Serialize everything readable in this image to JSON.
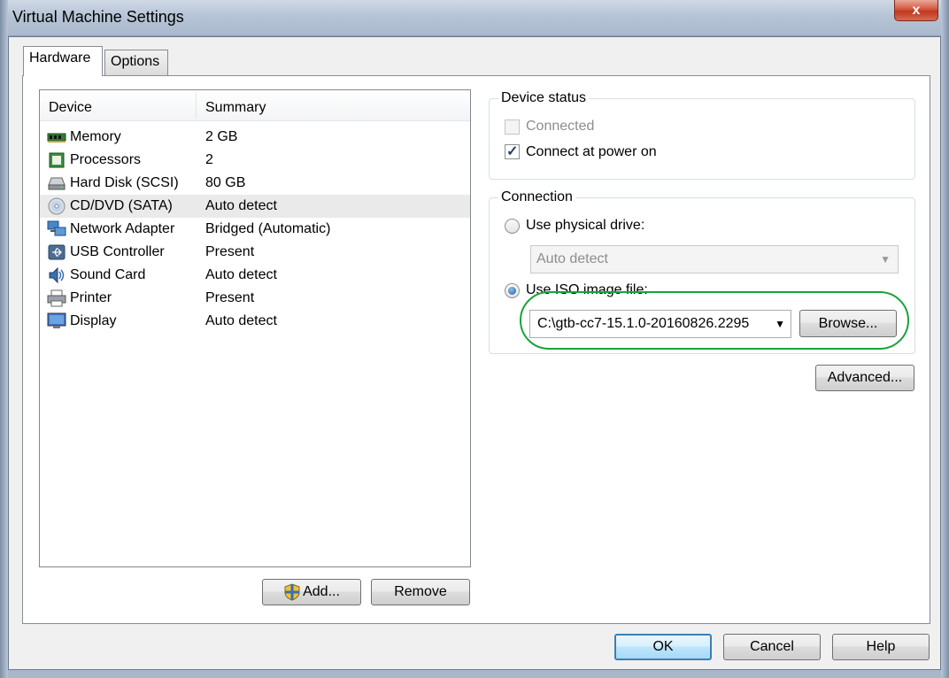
{
  "window": {
    "title": "Virtual Machine Settings",
    "close_glyph": "x"
  },
  "tabs": [
    {
      "label": "Hardware",
      "active": true
    },
    {
      "label": "Options",
      "active": false
    }
  ],
  "device_list": {
    "columns": {
      "device": "Device",
      "summary": "Summary"
    },
    "rows": [
      {
        "device": "Memory",
        "summary": "2 GB",
        "icon": "memory-icon"
      },
      {
        "device": "Processors",
        "summary": "2",
        "icon": "processor-icon"
      },
      {
        "device": "Hard Disk (SCSI)",
        "summary": "80 GB",
        "icon": "hard-disk-icon"
      },
      {
        "device": "CD/DVD (SATA)",
        "summary": "Auto detect",
        "icon": "cd-dvd-icon",
        "selected": true
      },
      {
        "device": "Network Adapter",
        "summary": "Bridged (Automatic)",
        "icon": "network-adapter-icon"
      },
      {
        "device": "USB Controller",
        "summary": "Present",
        "icon": "usb-icon"
      },
      {
        "device": "Sound Card",
        "summary": "Auto detect",
        "icon": "sound-card-icon"
      },
      {
        "device": "Printer",
        "summary": "Present",
        "icon": "printer-icon"
      },
      {
        "device": "Display",
        "summary": "Auto detect",
        "icon": "display-icon"
      }
    ]
  },
  "list_buttons": {
    "add": "Add...",
    "remove": "Remove"
  },
  "device_status": {
    "title": "Device status",
    "connected": {
      "label": "Connected",
      "checked": false,
      "enabled": false
    },
    "connect_at_power_on": {
      "label": "Connect at power on",
      "checked": true,
      "enabled": true
    },
    "check_glyph": "✓"
  },
  "connection": {
    "title": "Connection",
    "physical_drive": {
      "label": "Use physical drive:",
      "selected": false,
      "value": "Auto detect"
    },
    "iso_image": {
      "label": "Use ISO image file:",
      "selected": true,
      "value": "C:\\gtb-cc7-15.1.0-20160826.2295"
    },
    "browse_label": "Browse...",
    "arrow_glyph": "▼"
  },
  "advanced_label": "Advanced...",
  "footer": {
    "ok": "OK",
    "cancel": "Cancel",
    "help": "Help"
  },
  "colors": {
    "highlight": "#1aa33c",
    "selection": "#eaeaea",
    "default_button_border": "#3c7fb1"
  }
}
